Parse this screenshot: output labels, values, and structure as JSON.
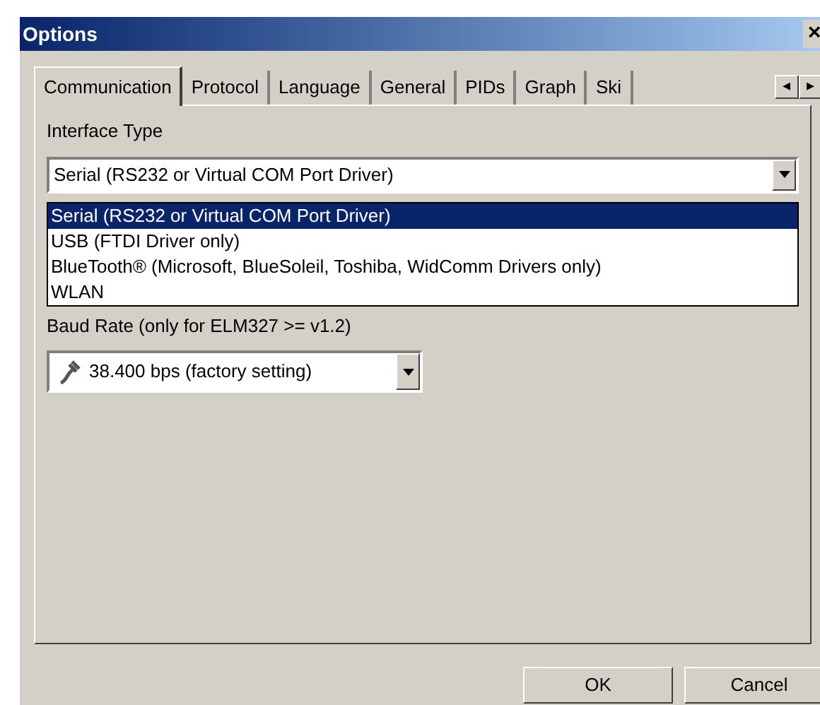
{
  "window": {
    "title": "Options",
    "close": "×"
  },
  "tabs": [
    {
      "label": "Communication",
      "selected": true
    },
    {
      "label": "Protocol",
      "selected": false
    },
    {
      "label": "Language",
      "selected": false
    },
    {
      "label": "General",
      "selected": false
    },
    {
      "label": "PIDs",
      "selected": false
    },
    {
      "label": "Graph",
      "selected": false
    },
    {
      "label": "Ski",
      "selected": false
    }
  ],
  "tab_scroll": [
    "◂",
    "▸"
  ],
  "interface_type": {
    "label": "Interface Type",
    "value": "Serial (RS232 or Virtual COM Port Driver)",
    "expanded": true,
    "options": [
      {
        "label": "Serial (RS232 or Virtual COM Port Driver)",
        "selected": true
      },
      {
        "label": "USB (FTDI Driver only)",
        "selected": false
      },
      {
        "label": "BlueTooth® (Microsoft, BlueSoleil, Toshiba, WidComm Drivers only)",
        "selected": false
      },
      {
        "label": "WLAN",
        "selected": false
      }
    ]
  },
  "baud_rate": {
    "label": "Baud Rate (only for ELM327 >= v1.2)",
    "value": "38.400 bps (factory setting)"
  },
  "buttons": [
    "OK",
    "Cancel"
  ]
}
